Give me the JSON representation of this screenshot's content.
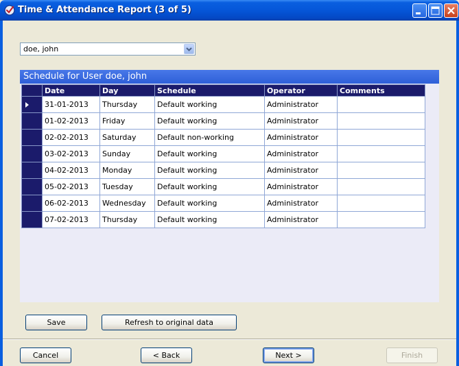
{
  "window": {
    "title": "Time & Attendance Report (3 of 5)",
    "icon": "app-check-icon",
    "controls": [
      "minimize-icon",
      "maximize-icon",
      "close-icon"
    ]
  },
  "user_select": {
    "value": "doe, john",
    "icon": "chevron-down-icon"
  },
  "schedule": {
    "header": "Schedule for User doe, john",
    "columns": [
      "Date",
      "Day",
      "Schedule",
      "Operator",
      "Comments"
    ],
    "current_row_indicator": "row-pointer-icon",
    "current_row": 0,
    "rows": [
      {
        "date": "31-01-2013",
        "day": "Thursday",
        "schedule": "Default working",
        "operator": "Administrator",
        "comments": ""
      },
      {
        "date": "01-02-2013",
        "day": "Friday",
        "schedule": "Default working",
        "operator": "Administrator",
        "comments": ""
      },
      {
        "date": "02-02-2013",
        "day": "Saturday",
        "schedule": "Default non-working",
        "operator": "Administrator",
        "comments": ""
      },
      {
        "date": "03-02-2013",
        "day": "Sunday",
        "schedule": "Default working",
        "operator": "Administrator",
        "comments": ""
      },
      {
        "date": "04-02-2013",
        "day": "Monday",
        "schedule": "Default working",
        "operator": "Administrator",
        "comments": ""
      },
      {
        "date": "05-02-2013",
        "day": "Tuesday",
        "schedule": "Default working",
        "operator": "Administrator",
        "comments": ""
      },
      {
        "date": "06-02-2013",
        "day": "Wednesday",
        "schedule": "Default working",
        "operator": "Administrator",
        "comments": ""
      },
      {
        "date": "07-02-2013",
        "day": "Thursday",
        "schedule": "Default working",
        "operator": "Administrator",
        "comments": ""
      }
    ]
  },
  "actions": {
    "save_label": "Save",
    "refresh_label": "Refresh to original data"
  },
  "wizard": {
    "cancel_label": "Cancel",
    "back_label": "< Back",
    "next_label": "Next >",
    "finish_label": "Finish",
    "finish_enabled": false
  },
  "colors": {
    "title_bar": "#0556d8",
    "panel_header": "#2e5fd8",
    "grid_header": "#1b1b6b",
    "panel_bg": "#ebebf7",
    "dialog_bg": "#ece9d8"
  }
}
